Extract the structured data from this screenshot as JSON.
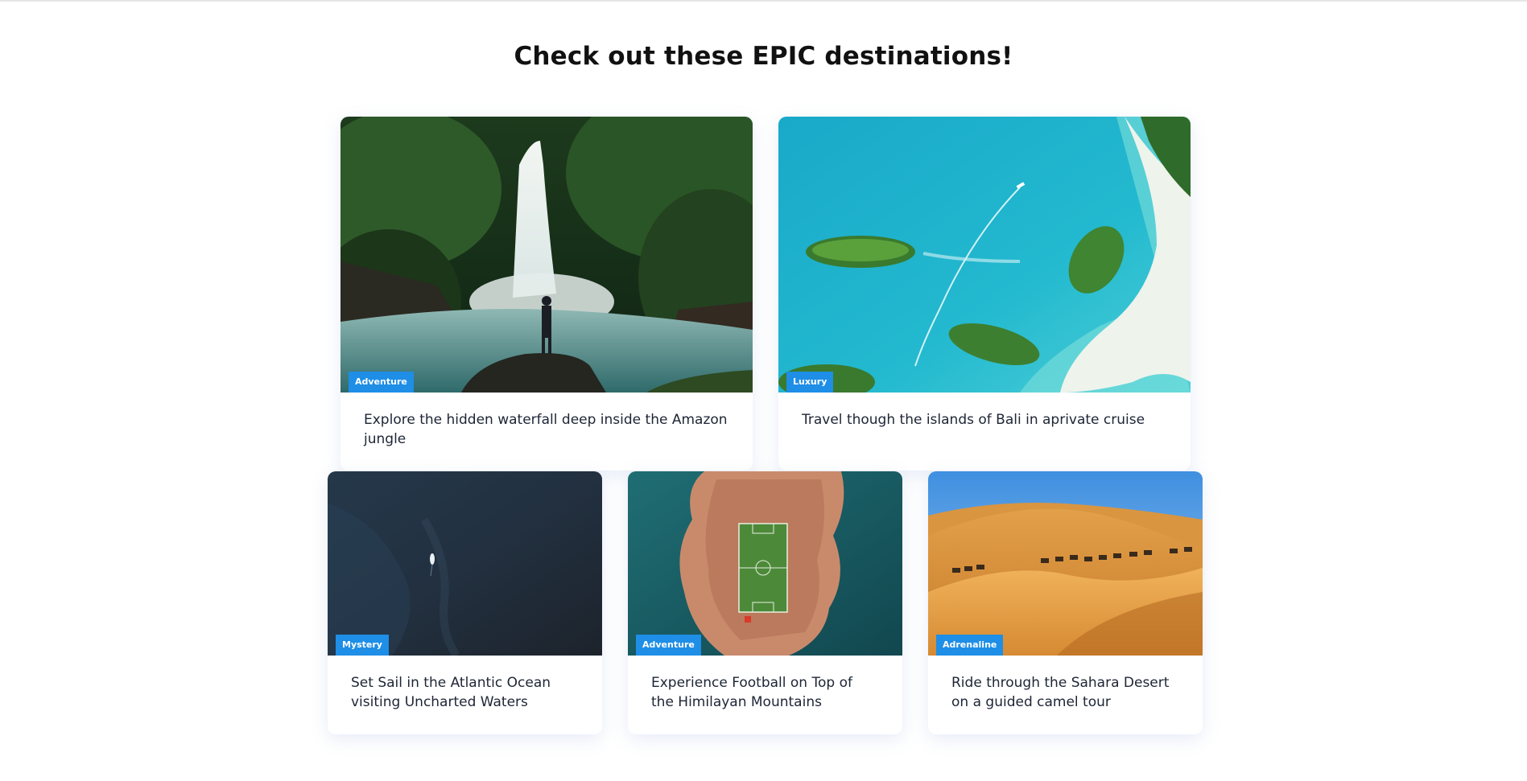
{
  "page": {
    "title": "Check out these EPIC destinations!"
  },
  "colors": {
    "tag_bg": "#1e8ee6",
    "caption_text": "#1d2535",
    "title_text": "#111111"
  },
  "cards": [
    {
      "tag": "Adventure",
      "caption": "Explore the hidden waterfall deep inside the Amazon jungle",
      "image": "waterfall-image"
    },
    {
      "tag": "Luxury",
      "caption": "Travel though the islands of Bali in aprivate cruise",
      "image": "bali-islands-image"
    },
    {
      "tag": "Mystery",
      "caption": "Set Sail in the Atlantic Ocean visiting Uncharted Waters",
      "image": "atlantic-ocean-image"
    },
    {
      "tag": "Adventure",
      "caption": "Experience Football on Top of the Himilayan Mountains",
      "image": "football-field-image"
    },
    {
      "tag": "Adrenaline",
      "caption": "Ride through the Sahara Desert on a guided camel tour",
      "image": "sahara-desert-image"
    }
  ]
}
